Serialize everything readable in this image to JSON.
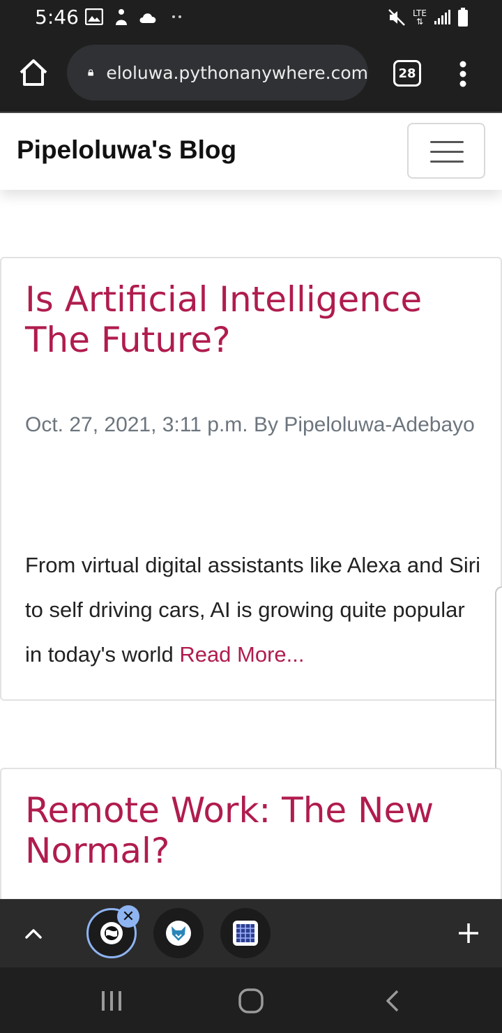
{
  "status": {
    "time": "5:46",
    "network": "LTE"
  },
  "browser": {
    "url": "eloluwa.pythonanywhere.com",
    "tab_count": "28"
  },
  "site": {
    "brand": "Pipeloluwa's Blog"
  },
  "posts": [
    {
      "title": "Is Artificial Intelligence The Future?",
      "meta": "Oct. 27, 2021, 3:11 p.m. By Pipeloluwa-Adebayo",
      "excerpt": "From virtual digital assistants like Alexa and Siri to self driving cars, AI is growing quite popular in today's world ",
      "read_more": "Read More..."
    },
    {
      "title": "Remote Work: The New Normal?"
    }
  ],
  "tab_strip": {
    "close_symbol": "✕"
  },
  "colors": {
    "accent": "#b01c4d",
    "meta": "#6c757d",
    "chrome_dark": "#1f1f1f",
    "tab_highlight": "#8eb4f2"
  },
  "icons": {
    "home": "home-icon",
    "lock": "lock-icon",
    "more": "more-vert-icon",
    "collapse": "chevron-up-icon",
    "new_tab": "plus-icon"
  }
}
